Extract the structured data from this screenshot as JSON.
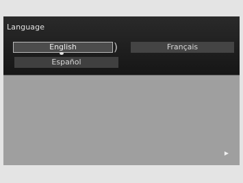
{
  "screen": {
    "title": "Language"
  },
  "languages": {
    "english": "English",
    "francais": "Français",
    "espanol": "Español"
  },
  "selection": {
    "selected_language": "English"
  },
  "navigation": {
    "next_icon": "triangle-right-icon"
  },
  "colors": {
    "top_panel": "#1d1d1d",
    "body_panel": "#9f9f9f",
    "selected_outline": "#bdbdbd"
  }
}
